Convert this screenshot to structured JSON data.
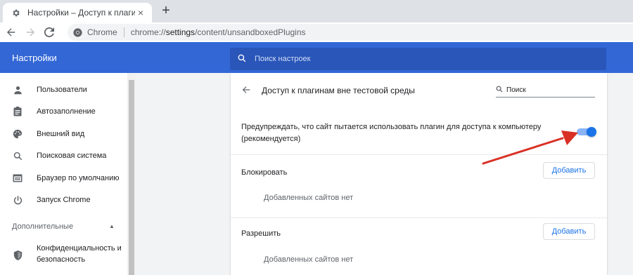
{
  "browser": {
    "tab_title": "Настройки – Доступ к плагина",
    "close_glyph": "×",
    "newtab_glyph": "+",
    "omnibox_site": "Chrome",
    "url_prefix": "chrome://",
    "url_host": "settings",
    "url_path": "/content/unsandboxedPlugins"
  },
  "header": {
    "title": "Настройки",
    "search_placeholder": "Поиск настроек"
  },
  "sidebar": {
    "items": [
      {
        "label": "Пользователи",
        "icon": "person-icon"
      },
      {
        "label": "Автозаполнение",
        "icon": "clipboard-icon"
      },
      {
        "label": "Внешний вид",
        "icon": "palette-icon"
      },
      {
        "label": "Поисковая система",
        "icon": "search-icon"
      },
      {
        "label": "Браузер по умолчанию",
        "icon": "browser-icon"
      },
      {
        "label": "Запуск Chrome",
        "icon": "power-icon"
      }
    ],
    "advanced_label": "Дополнительные",
    "advanced_caret": "▲",
    "privacy_label_1": "Конфиденциальность и",
    "privacy_label_2": "безопасность"
  },
  "page": {
    "title": "Доступ к плагинам вне тестовой среды",
    "search_placeholder": "Поиск",
    "warn_line1": "Предупреждать, что сайт пытается использовать плагин для доступа к компьютеру",
    "warn_line2": "(рекомендуется)",
    "toggle_on": true,
    "block_label": "Блокировать",
    "block_add": "Добавить",
    "block_empty": "Добавленных сайтов нет",
    "allow_label": "Разрешить",
    "allow_add": "Добавить",
    "allow_empty": "Добавленных сайтов нет"
  },
  "colors": {
    "header_blue": "#3367d6",
    "search_blue": "#2a56b9",
    "toggle_blue": "#1a73e8",
    "annotation_red": "#d93025"
  }
}
